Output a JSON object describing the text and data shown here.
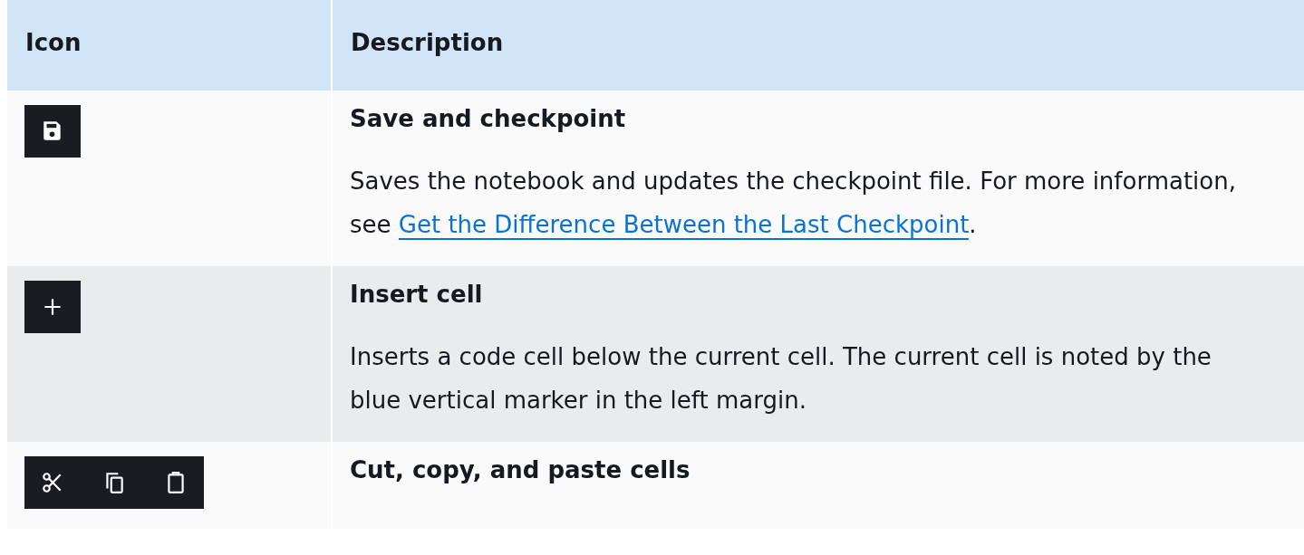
{
  "table": {
    "columns": [
      "Icon",
      "Description"
    ],
    "rows": [
      {
        "icons": [
          {
            "kind": "save"
          }
        ],
        "title": "Save and checkpoint",
        "description": "Saves the notebook and updates the checkpoint file. For more information, see ",
        "link": "Get the Difference Between the Last Checkpoint",
        "after": "."
      },
      {
        "icons": [
          {
            "kind": "plus"
          }
        ],
        "title": "Insert cell",
        "description": "Inserts a code cell below the current cell. The current cell is noted by the blue vertical marker in the left margin."
      },
      {
        "icons": [
          {
            "kind": "scissors"
          },
          {
            "kind": "copy"
          },
          {
            "kind": "clipboard"
          }
        ],
        "title": "Cut, copy, and paste cells"
      }
    ]
  }
}
